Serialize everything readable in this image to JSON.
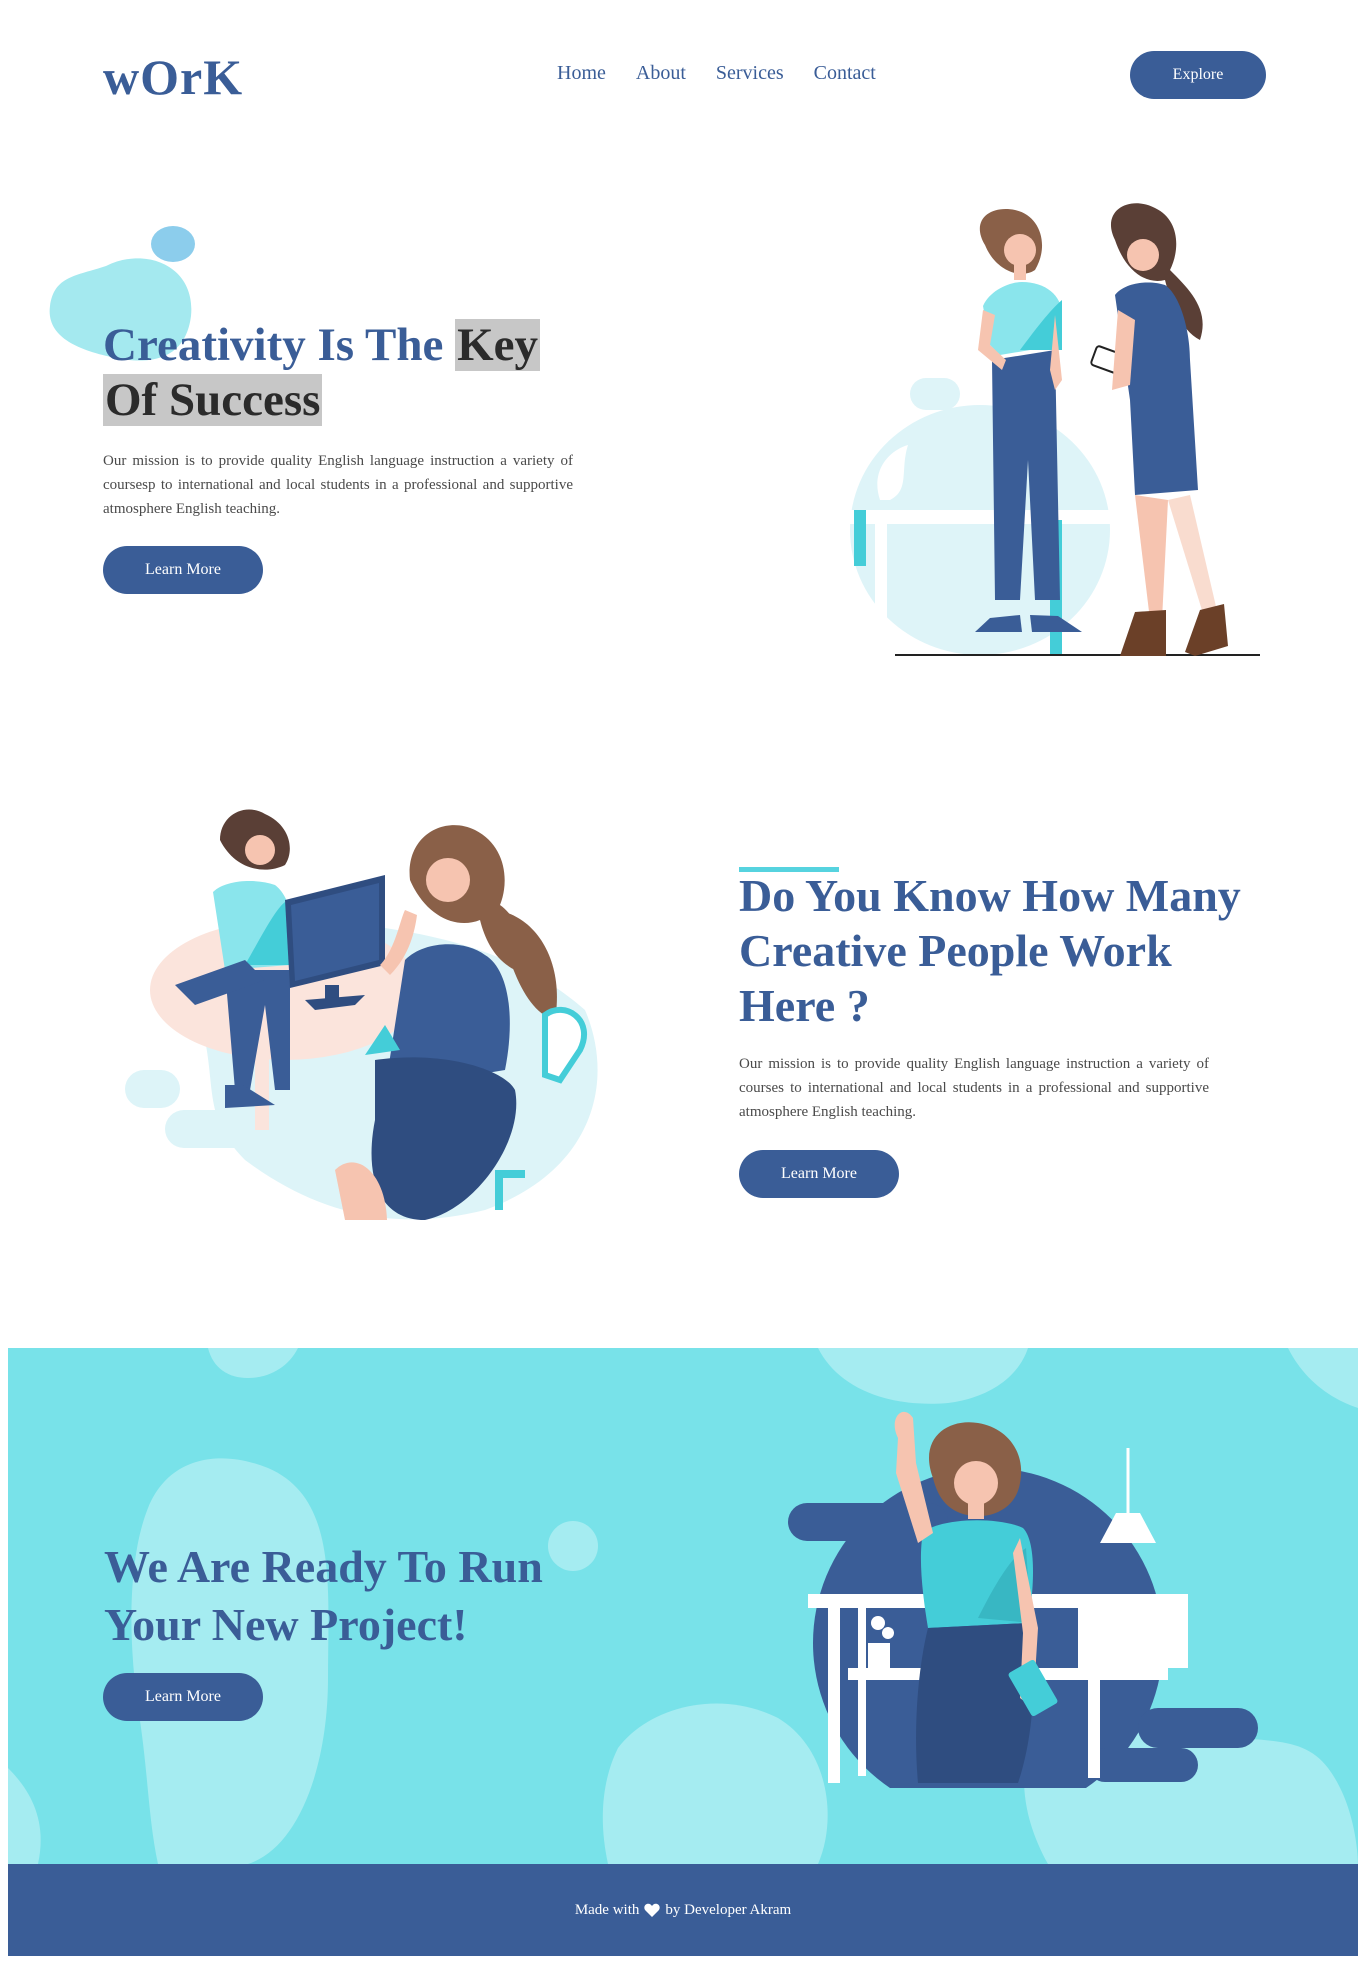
{
  "nav": {
    "logo": "wOrK",
    "links": [
      "Home",
      "About",
      "Services",
      "Contact"
    ],
    "explore_label": "Explore"
  },
  "hero": {
    "title_plain": "Creativity Is The ",
    "title_hl1": "Key",
    "title_hl2": "Of Success",
    "paragraph": "Our mission is to provide quality English language instruction a variety of coursesp to international and local students in a professional and supportive atmosphere English teaching.",
    "button_label": "Learn More"
  },
  "section2": {
    "title": "Do You Know How Many Creative People Work Here ?",
    "paragraph": "Our mission is to provide quality English language instruction a variety of courses to international and local students in a professional and supportive atmosphere English teaching.",
    "button_label": "Learn More"
  },
  "section3": {
    "title": "We Are Ready To Run Your New Project!",
    "button_label": "Learn More"
  },
  "footer": {
    "prefix": "Made with",
    "heart_icon": "heart-icon",
    "suffix": "by Developer Akram"
  },
  "colors": {
    "primary": "#3a5d97",
    "accent": "#56d3df",
    "band": "#78e2e9",
    "highlight": "#c7c7c7"
  }
}
